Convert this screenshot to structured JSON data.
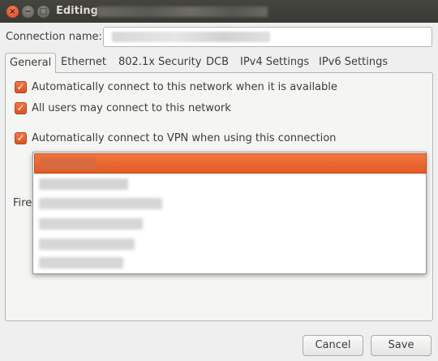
{
  "window": {
    "title": "Editing",
    "close_icon": "×",
    "minimize_icon": "−",
    "maximize_icon": "□"
  },
  "connection": {
    "label": "Connection name:"
  },
  "tabs": [
    {
      "label": "General",
      "active": true
    },
    {
      "label": "Ethernet"
    },
    {
      "label": "802.1x Security"
    },
    {
      "label": "DCB"
    },
    {
      "label": "IPv4 Settings"
    },
    {
      "label": "IPv6 Settings"
    }
  ],
  "general": {
    "options": [
      {
        "label": "Automatically connect to this network when it is available",
        "checked": true
      },
      {
        "label": "All users may connect to this network",
        "checked": true
      },
      {
        "label": "Automatically connect to VPN when using this connection",
        "checked": true
      }
    ],
    "firewall_label_partial": "Fire",
    "check_mark": "✓"
  },
  "buttons": {
    "cancel": "Cancel",
    "save": "Save"
  },
  "colors": {
    "accent": "#e95420",
    "titlebar": "#3c3b37",
    "background": "#efefef"
  }
}
